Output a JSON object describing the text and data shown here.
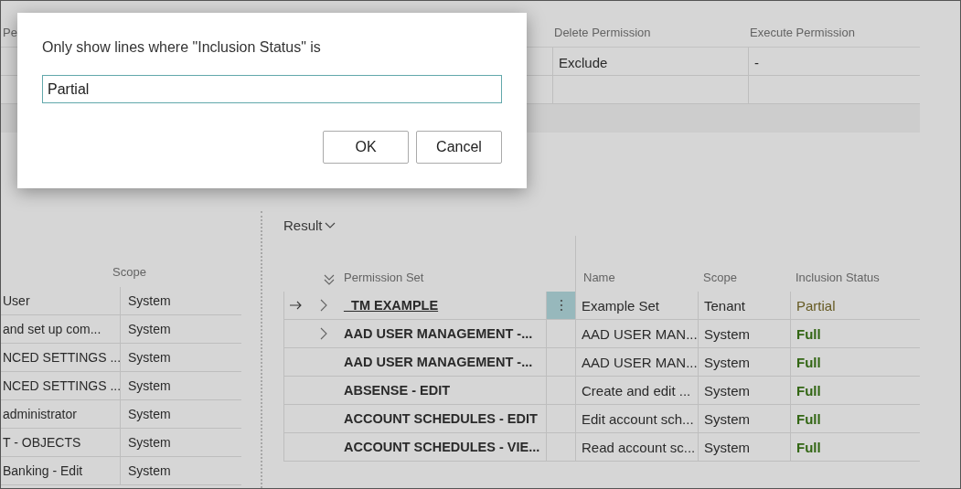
{
  "top_table": {
    "columns": [
      "Pe",
      "Delete Permission",
      "Execute Permission"
    ],
    "rows": [
      [
        "",
        "Exclude",
        "-"
      ],
      [
        "",
        "",
        ""
      ]
    ]
  },
  "left_table": {
    "columns": [
      "",
      "Scope"
    ],
    "rows": [
      [
        "User",
        "System"
      ],
      [
        "and set up com...",
        "System"
      ],
      [
        "NCED SETTINGS ...",
        "System"
      ],
      [
        "NCED SETTINGS ...",
        "System"
      ],
      [
        "administrator",
        "System"
      ],
      [
        "T - OBJECTS",
        "System"
      ],
      [
        "Banking - Edit",
        "System"
      ]
    ]
  },
  "result": {
    "title": "Result",
    "columns": [
      "Permission Set",
      "Name",
      "Scope",
      "Inclusion Status"
    ],
    "rows": [
      {
        "selected": true,
        "has_children": true,
        "permission_set": "_TM EXAMPLE",
        "name": "Example Set",
        "scope": "Tenant",
        "inclusion_status": "Partial",
        "kind": "partial"
      },
      {
        "selected": false,
        "has_children": true,
        "permission_set": "AAD USER MANAGEMENT -...",
        "name": "AAD USER MAN...",
        "scope": "System",
        "inclusion_status": "Full",
        "kind": "full"
      },
      {
        "selected": false,
        "has_children": false,
        "permission_set": "AAD USER MANAGEMENT -...",
        "name": "AAD USER MAN...",
        "scope": "System",
        "inclusion_status": "Full",
        "kind": "full"
      },
      {
        "selected": false,
        "has_children": false,
        "permission_set": "ABSENSE - EDIT",
        "name": "Create and edit ...",
        "scope": "System",
        "inclusion_status": "Full",
        "kind": "full"
      },
      {
        "selected": false,
        "has_children": false,
        "permission_set": "ACCOUNT SCHEDULES - EDIT",
        "name": "Edit account sch...",
        "scope": "System",
        "inclusion_status": "Full",
        "kind": "full"
      },
      {
        "selected": false,
        "has_children": false,
        "permission_set": "ACCOUNT SCHEDULES - VIE...",
        "name": "Read account sc...",
        "scope": "System",
        "inclusion_status": "Full",
        "kind": "full"
      }
    ]
  },
  "dialog": {
    "prompt": "Only show lines where \"Inclusion Status\" is",
    "value": "Partial",
    "buttons": [
      "OK",
      "Cancel"
    ]
  }
}
